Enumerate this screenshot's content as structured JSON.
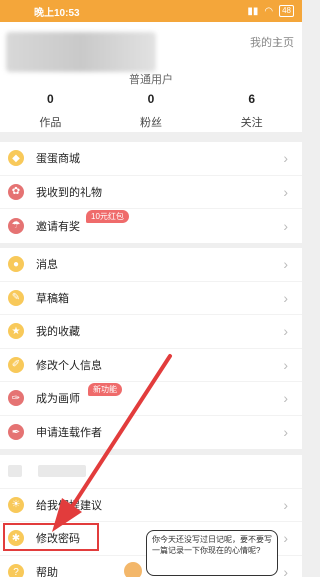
{
  "status_bar": {
    "time": "晚上10:53",
    "battery": "48"
  },
  "profile": {
    "homepage_link": "我的主页",
    "level": "普通用户",
    "stats": [
      {
        "value": "0",
        "label": "作品"
      },
      {
        "value": "0",
        "label": "粉丝"
      },
      {
        "value": "6",
        "label": "关注"
      }
    ]
  },
  "menu_group_1": [
    {
      "label": "蛋蛋商城",
      "icon": "egg-icon"
    },
    {
      "label": "我收到的礼物",
      "icon": "gift-icon"
    },
    {
      "label": "邀请有奖",
      "icon": "invite-icon",
      "badge": "10元红包"
    }
  ],
  "menu_group_2": [
    {
      "label": "消息",
      "icon": "message-icon"
    },
    {
      "label": "草稿箱",
      "icon": "draft-icon"
    },
    {
      "label": "我的收藏",
      "icon": "star-icon"
    },
    {
      "label": "修改个人信息",
      "icon": "edit-icon"
    },
    {
      "label": "成为画师",
      "icon": "brush-icon",
      "badge": "新功能"
    },
    {
      "label": "申请连载作者",
      "icon": "pen-icon"
    }
  ],
  "menu_group_3": [
    {
      "label": "给我们提建议",
      "icon": "bulb-icon"
    },
    {
      "label": "修改密码",
      "icon": "asterisk-icon"
    },
    {
      "label": "帮助",
      "icon": "help-icon"
    }
  ],
  "tooltip": {
    "text": "你今天还没写过日记呢，要不要写一篇记录一下你现在的心情呢?"
  },
  "colors": {
    "accent": "#f4a63a",
    "highlight": "#e23c3c",
    "badge": "#ef6b6b"
  }
}
